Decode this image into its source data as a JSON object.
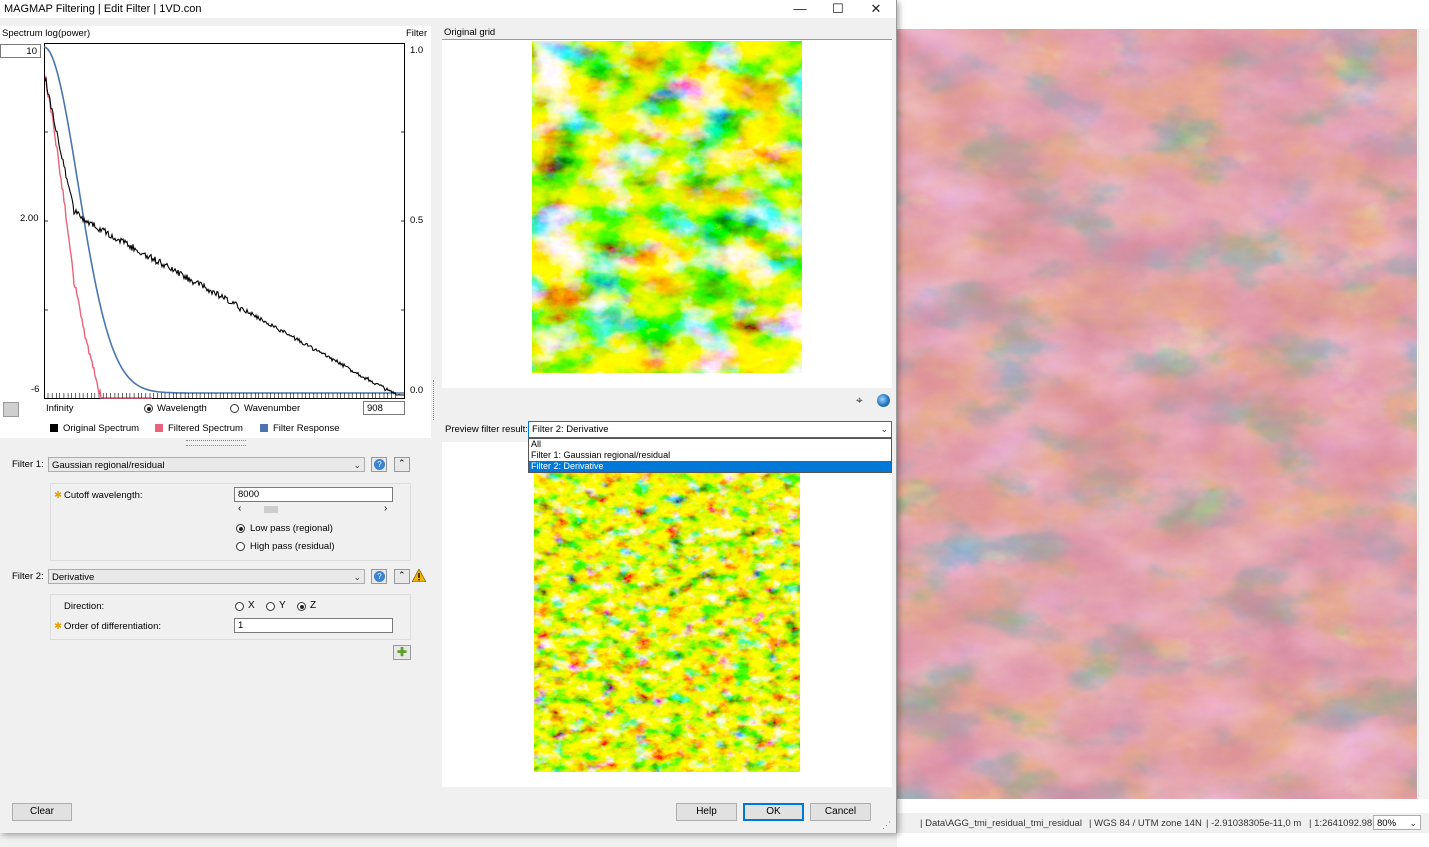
{
  "window": {
    "title": "MAGMAP Filtering | Edit Filter | 1VD.con"
  },
  "spectrum": {
    "header_left": "Spectrum log(power)",
    "header_right": "Filter",
    "y_top_value": "10",
    "y_mid": "2.00",
    "y_bottom": "-6",
    "right_top": "1.0",
    "right_mid": "0.5",
    "right_bottom": "0.0",
    "x_left": "Infinity",
    "radio_wavelength": "Wavelength",
    "radio_wavenumber": "Wavenumber",
    "x_value": "908",
    "legend": [
      {
        "label": "Original Spectrum",
        "color": "#000000"
      },
      {
        "label": "Filtered Spectrum",
        "color": "#e8637a"
      },
      {
        "label": "Filter Response",
        "color": "#4a75b0"
      }
    ]
  },
  "original_grid": {
    "label": "Original grid"
  },
  "preview": {
    "label": "Preview filter result:",
    "selected": "Filter 2: Derivative",
    "options": [
      "All",
      "Filter 1: Gaussian regional/residual",
      "Filter 2: Derivative"
    ]
  },
  "filter1": {
    "label": "Filter 1:",
    "type": "Gaussian regional/residual",
    "cutoff_label": "Cutoff wavelength:",
    "cutoff_value": "8000",
    "low_pass": "Low pass (regional)",
    "high_pass": "High pass (residual)"
  },
  "filter2": {
    "label": "Filter 2:",
    "type": "Derivative",
    "direction_label": "Direction:",
    "dir_x": "X",
    "dir_y": "Y",
    "dir_z": "Z",
    "order_label": "Order of differentiation:",
    "order_value": "1"
  },
  "buttons": {
    "clear": "Clear",
    "help": "Help",
    "ok": "OK",
    "cancel": "Cancel"
  },
  "statusbar": {
    "path": "| Data\\AGG_tmi_residual_tmi_residual",
    "crs": "| WGS 84 / UTM zone 14N",
    "coords": "| -2.91038305e-11,0 m",
    "scale": "| 1:2641092.98",
    "zoom": "80%"
  }
}
